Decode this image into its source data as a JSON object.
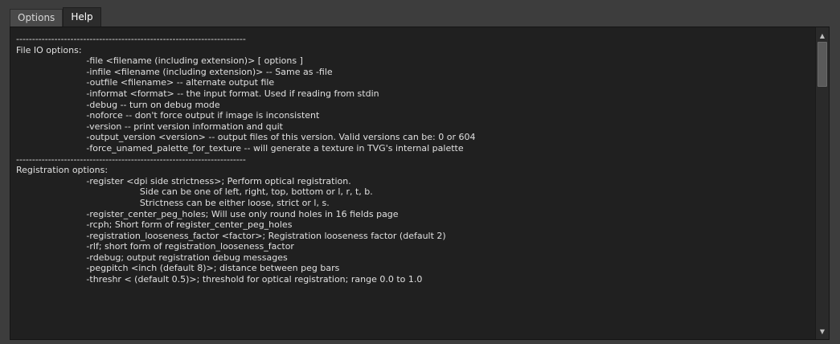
{
  "tabs": [
    {
      "label": "Options",
      "active": false
    },
    {
      "label": "Help",
      "active": true
    }
  ],
  "help_lines": [
    "------------------------------------------------------------------------",
    "File IO options:",
    "                         -file <filename (including extension)> [ options ]",
    "                         -infile <filename (including extension)> -- Same as -file",
    "                         -outfile <filename> -- alternate output file",
    "                         -informat <format> -- the input format. Used if reading from stdin",
    "                         -debug -- turn on debug mode",
    "                         -noforce -- don't force output if image is inconsistent",
    "                         -version -- print version information and quit",
    "                         -output_version <version> -- output files of this version. Valid versions can be: 0 or 604",
    "                         -force_unamed_palette_for_texture -- will generate a texture in TVG's internal palette",
    "------------------------------------------------------------------------",
    "Registration options:",
    "                         -register <dpi side strictness>; Perform optical registration.",
    "                                            Side can be one of left, right, top, bottom or l, r, t, b.",
    "                                            Strictness can be either loose, strict or l, s.",
    "                         -register_center_peg_holes; Will use only round holes in 16 fields page",
    "                         -rcph; Short form of register_center_peg_holes",
    "                         -registration_looseness_factor <factor>; Registration looseness factor (default 2)",
    "                         -rlf; short form of registration_looseness_factor",
    "                         -rdebug; output registration debug messages",
    "                         -pegpitch <inch (default 8)>; distance between peg bars",
    "                         -threshr < (default 0.5)>; threshold for optical registration; range 0.0 to 1.0"
  ],
  "icons": {
    "scroll_up": "triangle-up",
    "scroll_down": "triangle-down"
  },
  "scroll": {
    "position_fraction": 0.0
  }
}
